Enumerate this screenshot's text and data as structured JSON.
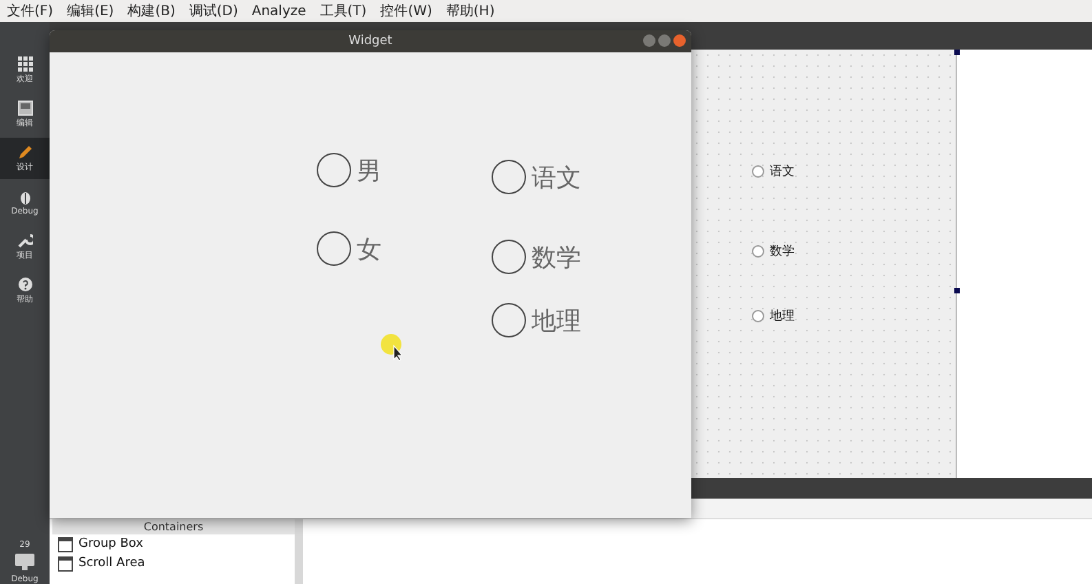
{
  "menu": [
    "文件(F)",
    "编辑(E)",
    "构建(B)",
    "调试(D)",
    "Analyze",
    "工具(T)",
    "控件(W)",
    "帮助(H)"
  ],
  "sidebar": {
    "items": [
      {
        "label": "欢迎",
        "selected": false
      },
      {
        "label": "编辑",
        "selected": false
      },
      {
        "label": "设计",
        "selected": true
      },
      {
        "label": "Debug",
        "selected": false
      },
      {
        "label": "项目",
        "selected": false
      },
      {
        "label": "帮助",
        "selected": false
      }
    ],
    "footer": {
      "count": "29",
      "label": "Debug"
    }
  },
  "widget_window": {
    "title": "Widget",
    "radios": [
      {
        "label": "男",
        "checked": false
      },
      {
        "label": "女",
        "checked": false
      },
      {
        "label": "语文",
        "checked": false
      },
      {
        "label": "数学",
        "checked": false
      },
      {
        "label": "地理",
        "checked": false
      }
    ]
  },
  "designer_form": {
    "radios": [
      {
        "label": "语文",
        "checked": false
      },
      {
        "label": "数学",
        "checked": false
      },
      {
        "label": "地理",
        "checked": false
      }
    ]
  },
  "widget_box": {
    "header": "Containers",
    "items": [
      "Group Box",
      "Scroll Area"
    ]
  }
}
